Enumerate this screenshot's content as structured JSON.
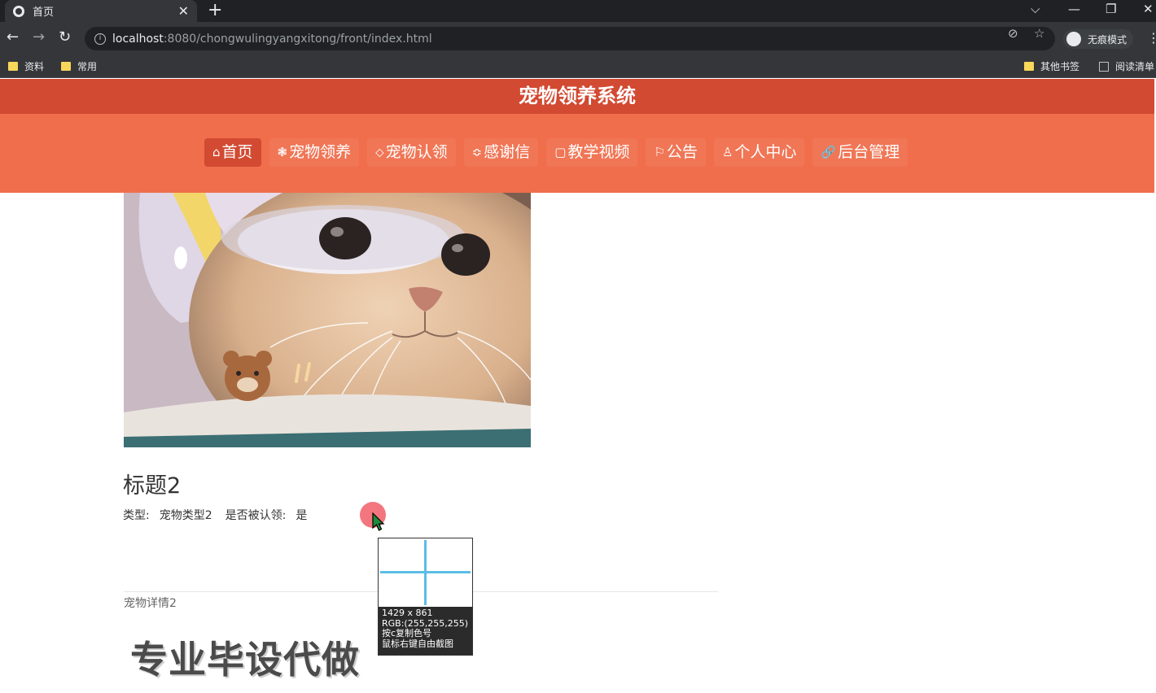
{
  "browser": {
    "tab_title": "首页",
    "tab_close": "✕",
    "new_tab": "+",
    "window_controls": {
      "tabs_menu": "⌵",
      "minimize": "—",
      "restore": "❐",
      "close": "✕"
    },
    "url_host": "localhost",
    "url_rest": ":8080/chongwulingyangxitong/front/index.html",
    "incognito_label": "无痕模式",
    "bookmarks": [
      "资料",
      "常用"
    ],
    "other_bookmarks": "其他书签",
    "reading_list": "阅读清单"
  },
  "site": {
    "title": "宠物领养系统",
    "nav": [
      {
        "icon": "⌂",
        "label": "首页"
      },
      {
        "icon": "❃",
        "label": "宠物领养"
      },
      {
        "icon": "⬦",
        "label": "宠物认领"
      },
      {
        "icon": "≎",
        "label": "感谢信"
      },
      {
        "icon": "▢",
        "label": "教学视频"
      },
      {
        "icon": "⚐",
        "label": "公告"
      },
      {
        "icon": "♙",
        "label": "个人中心"
      },
      {
        "icon": "🔗",
        "label": "后台管理"
      }
    ]
  },
  "detail": {
    "title": "标题2",
    "type_label": "类型:",
    "type_value": "宠物类型2",
    "claimed_label": "是否被认领:",
    "claimed_value": "是",
    "description": "宠物详情2",
    "watermark": "专业毕设代做"
  },
  "overlay": {
    "size_text": "1429 x 861",
    "rgb_text": "RGB:(255,255,255)",
    "copy_hint": "按c复制色号",
    "capture_hint": "鼠标右键自由截图"
  },
  "colors": {
    "header": "#d24a32",
    "nav": "#f06e4c",
    "active_nav": "#d24a32"
  }
}
